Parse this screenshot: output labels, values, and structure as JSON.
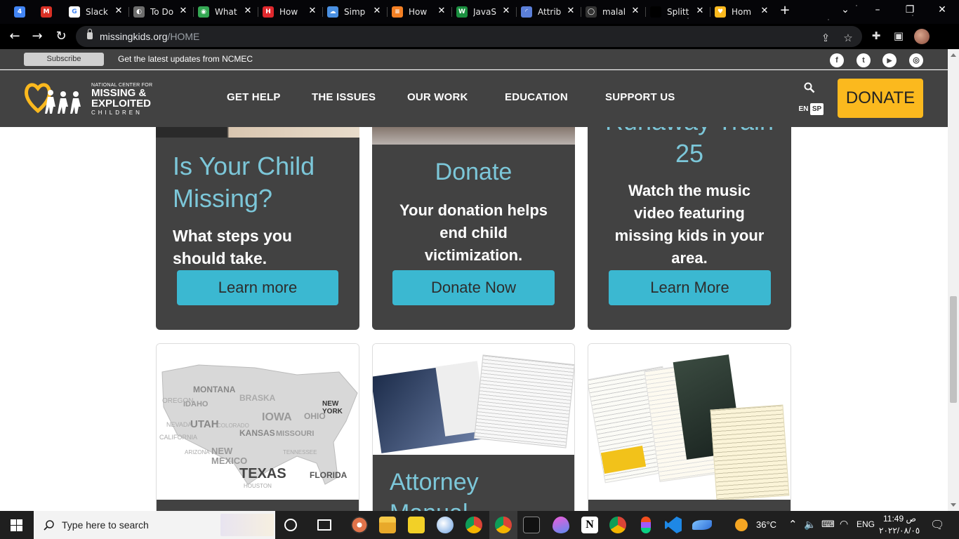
{
  "browser": {
    "tabs": [
      {
        "title": "",
        "fav_color": "#4285f4",
        "fav_glyph": "4"
      },
      {
        "title": "",
        "fav_color": "#d93025",
        "fav_glyph": "M"
      },
      {
        "title": "Slack",
        "fav_color": "#ffffff",
        "fav_glyph": "G"
      },
      {
        "title": "To Do",
        "fav_color": "#6d6d6d",
        "fav_glyph": "◐"
      },
      {
        "title": "What",
        "fav_color": "#34a853",
        "fav_glyph": "◉"
      },
      {
        "title": "How",
        "fav_color": "#e0282d",
        "fav_glyph": "H"
      },
      {
        "title": "Simp",
        "fav_color": "#4a90e2",
        "fav_glyph": "☁"
      },
      {
        "title": "How",
        "fav_color": "#f48024",
        "fav_glyph": "≡"
      },
      {
        "title": "JavaS",
        "fav_color": "#1a8f3f",
        "fav_glyph": "W"
      },
      {
        "title": "Attrib",
        "fav_color": "#5b7fd9",
        "fav_glyph": "◜"
      },
      {
        "title": "malal",
        "fav_color": "#333333",
        "fav_glyph": "◯"
      },
      {
        "title": "Splitt",
        "fav_color": "#000000",
        "fav_glyph": ""
      },
      {
        "title": "Hom",
        "fav_color": "#fbb91e",
        "fav_glyph": "♥"
      }
    ],
    "url_host": "missingkids.org",
    "url_path": "/HOME"
  },
  "topbar": {
    "subscribe_label": "Subscribe",
    "message": "Get the latest updates from NCMEC",
    "social": [
      "f",
      "t",
      "▶",
      "◎"
    ]
  },
  "nav": {
    "logo_line1": "NATIONAL CENTER FOR",
    "logo_line2": "MISSING &",
    "logo_line3": "EXPLOITED",
    "logo_line4": "CHILDREN",
    "links": [
      "GET HELP",
      "THE ISSUES",
      "OUR WORK",
      "EDUCATION",
      "SUPPORT US"
    ],
    "lang_en": "EN",
    "lang_sp": "SP",
    "donate_label": "DONATE"
  },
  "cards": [
    {
      "title_line1": "Is Your Child",
      "title_line2": "Missing?",
      "body_line1": "What steps you",
      "body_line2": "should take.",
      "button": "Learn more"
    },
    {
      "title": "Donate",
      "body_line1": "Your donation helps",
      "body_line2": "end child",
      "body_line3": "victimization.",
      "button": "Donate Now"
    },
    {
      "title_line1": "Runaway Train",
      "title_line2": "25",
      "body_line1": "Watch the music",
      "body_line2": "video featuring",
      "body_line3": "missing kids in your",
      "body_line4": "area.",
      "button": "Learn More"
    }
  ],
  "lower_cards": [
    {
      "map_labels": [
        "MONTANA",
        "IDAHO",
        "UTAH",
        "NEW MEXICO",
        "TEXAS",
        "KANSAS",
        "MISSOURI",
        "IOWA",
        "OHIO",
        "NEW YORK",
        "FLORIDA",
        "OREGON",
        "NEVADA",
        "CALIFORNIA",
        "ARIZONA",
        "COLORADO",
        "BRASKA",
        "TENNESSEE",
        "HOUSTON"
      ]
    },
    {
      "title": "Attorney",
      "title_line2": "Manual"
    },
    {
      "image": "child-sexual-abuse-brochure"
    }
  ],
  "taskbar": {
    "search_placeholder": "Type here to search",
    "temperature": "36°C",
    "lang": "ENG",
    "time": "11:49 ص",
    "date": "٢٠٢٢/٠٨/٠٥"
  }
}
